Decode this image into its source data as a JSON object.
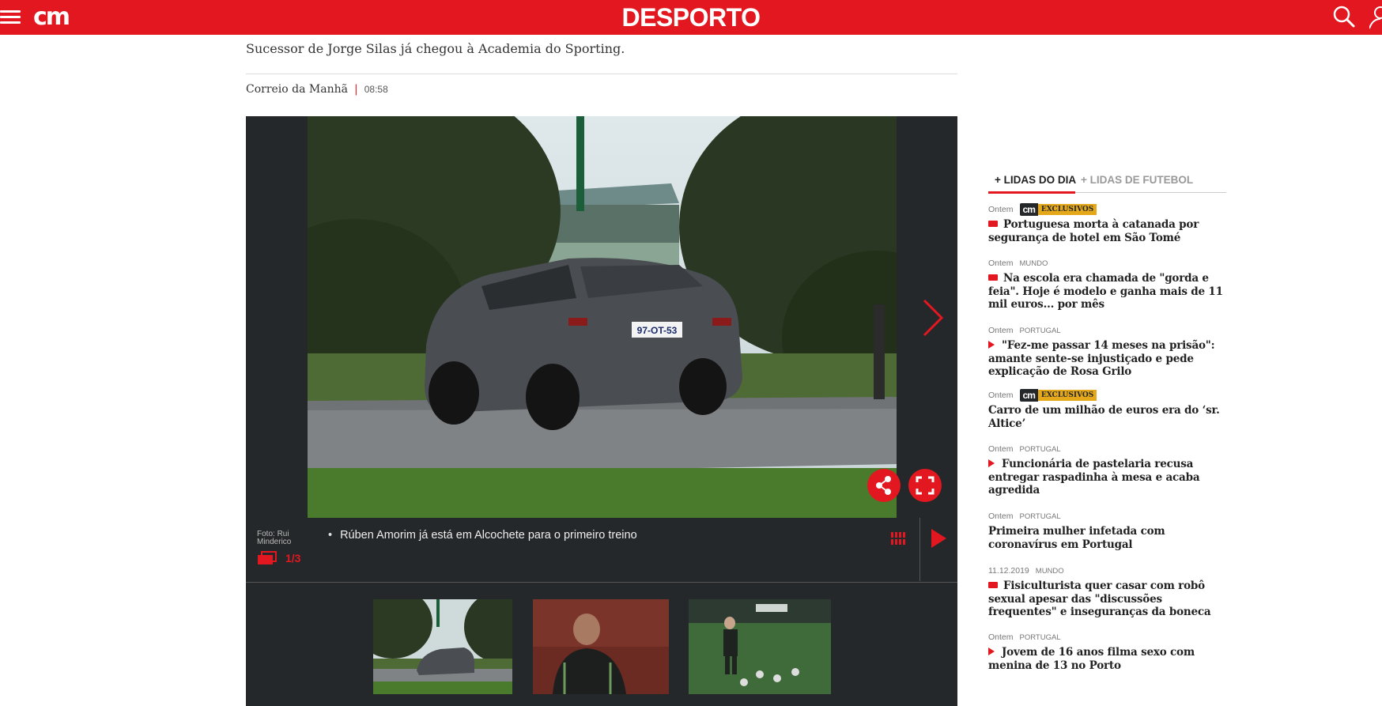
{
  "header": {
    "logo": "cm",
    "section": "DESPORTO",
    "icons": [
      "menu-icon",
      "search-icon",
      "user-icon"
    ],
    "accent_color": "#e3171f"
  },
  "article": {
    "lead": "Sucessor de Jorge Silas já chegou à Academia do Sporting.",
    "source": "Correio da Manhã",
    "separator": "|",
    "time": "08:58"
  },
  "gallery": {
    "credit": "Foto: Rui Minderico",
    "counter": "1/3",
    "caption": "Rúben Amorim já está em Alcochete para o primeiro treino",
    "plate": "97-OT-53",
    "thumbnails": [
      "Range Rover na Academia",
      "Treinador no relvado",
      "Treino com bolas"
    ]
  },
  "sidebar": {
    "tabs": [
      "+ LIDAS DO DIA",
      "+ LIDAS DE FUTEBOL"
    ],
    "exclusive_badge": {
      "logo": "cm",
      "label": "EXCLUSIVOS"
    },
    "items": [
      {
        "date": "Ontem",
        "category": "",
        "exclusive": true,
        "icon": "gallery-icon",
        "title": "Portuguesa morta à catanada por segurança de hotel em São Tomé"
      },
      {
        "date": "Ontem",
        "category": "MUNDO",
        "exclusive": false,
        "icon": "gallery-icon",
        "title": "Na escola era chamada de \"gorda e feia\". Hoje é modelo e ganha mais de 11 mil euros... por mês"
      },
      {
        "date": "Ontem",
        "category": "PORTUGAL",
        "exclusive": false,
        "icon": "video-icon",
        "title": "\"Fez-me passar 14 meses na prisão\": amante sente-se injustiçado e pede explicação de Rosa Grilo"
      },
      {
        "date": "Ontem",
        "category": "",
        "exclusive": true,
        "icon": "",
        "title": "Carro de um milhão de euros era do ‘sr. Altice’"
      },
      {
        "date": "Ontem",
        "category": "PORTUGAL",
        "exclusive": false,
        "icon": "video-icon",
        "title": "Funcionária de pastelaria recusa entregar raspadinha à mesa e acaba agredida"
      },
      {
        "date": "Ontem",
        "category": "PORTUGAL",
        "exclusive": false,
        "icon": "",
        "title": "Primeira mulher infetada com coronavírus em Portugal"
      },
      {
        "date": "11.12.2019",
        "category": "MUNDO",
        "exclusive": false,
        "icon": "gallery-icon",
        "title": "Fisiculturista quer casar com robô sexual apesar das \"discussões frequentes\" e inseguranças da boneca"
      },
      {
        "date": "Ontem",
        "category": "PORTUGAL",
        "exclusive": false,
        "icon": "video-icon",
        "title": "Jovem de 16 anos filma sexo com menina de 13 no Porto"
      }
    ]
  }
}
